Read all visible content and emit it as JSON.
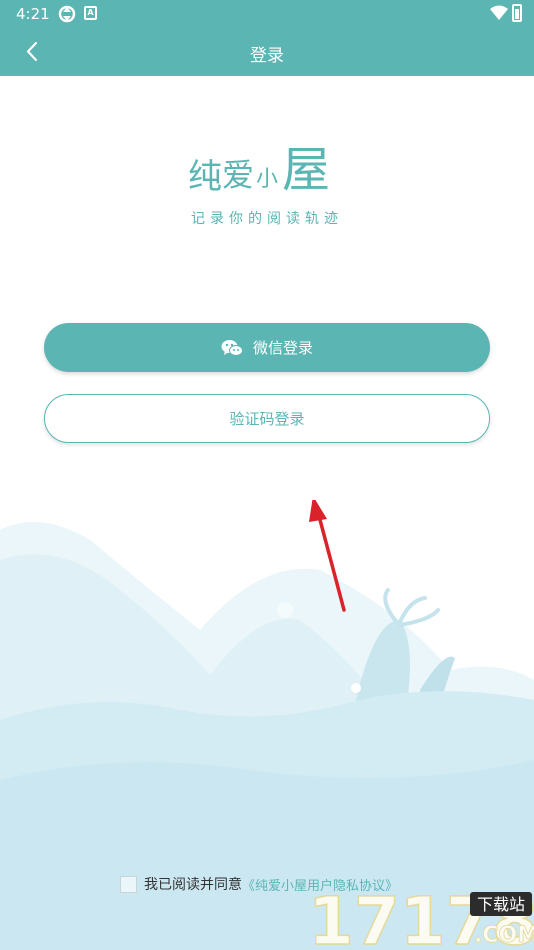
{
  "status_bar": {
    "time": "4:21"
  },
  "app_bar": {
    "title": "登录",
    "back_icon": "chevron-left-icon"
  },
  "logo": {
    "text": "纯爱小屋"
  },
  "slogan": "记录你的阅读轨迹",
  "buttons": {
    "wechat_label": "微信登录",
    "code_label": "验证码登录"
  },
  "agreement": {
    "text": "我已阅读并同意",
    "link": "《纯爱小屋用户隐私协议》",
    "checked": false
  },
  "watermark": {
    "text": "17178",
    "badge": "下载站",
    "suffix": ".COM"
  },
  "colors": {
    "accent": "#5bb5b3",
    "arrow": "#d9222a"
  }
}
